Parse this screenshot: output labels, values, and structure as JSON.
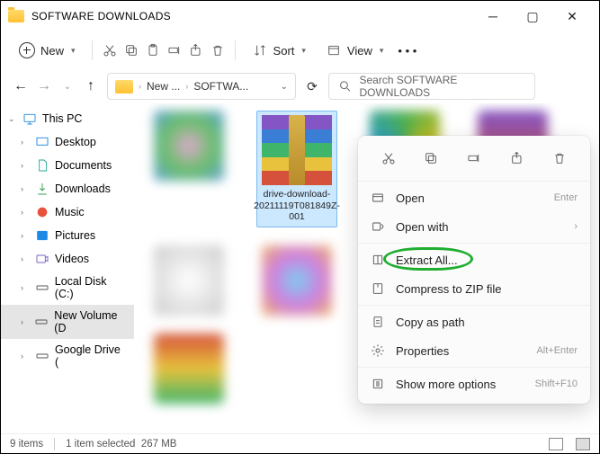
{
  "window": {
    "title": "SOFTWARE DOWNLOADS"
  },
  "toolbar": {
    "new": "New",
    "sort": "Sort",
    "view": "View"
  },
  "breadcrumb": {
    "seg1": "New ...",
    "seg2": "SOFTWA..."
  },
  "search": {
    "placeholder": "Search SOFTWARE DOWNLOADS"
  },
  "sidebar": {
    "root": "This PC",
    "items": [
      {
        "label": "Desktop"
      },
      {
        "label": "Documents"
      },
      {
        "label": "Downloads"
      },
      {
        "label": "Music"
      },
      {
        "label": "Pictures"
      },
      {
        "label": "Videos"
      },
      {
        "label": "Local Disk (C:)"
      },
      {
        "label": "New Volume (D"
      },
      {
        "label": "Google Drive ("
      }
    ]
  },
  "selected_file": {
    "name": "drive-download-20211119T081849Z-001"
  },
  "context_menu": {
    "open": {
      "label": "Open",
      "accel": "Enter"
    },
    "open_with": {
      "label": "Open with"
    },
    "extract_all": {
      "label": "Extract All..."
    },
    "compress": {
      "label": "Compress to ZIP file"
    },
    "copy_path": {
      "label": "Copy as path"
    },
    "properties": {
      "label": "Properties",
      "accel": "Alt+Enter"
    },
    "more": {
      "label": "Show more options",
      "accel": "Shift+F10"
    }
  },
  "status": {
    "count": "9 items",
    "selection": "1 item selected",
    "size": "267 MB"
  }
}
